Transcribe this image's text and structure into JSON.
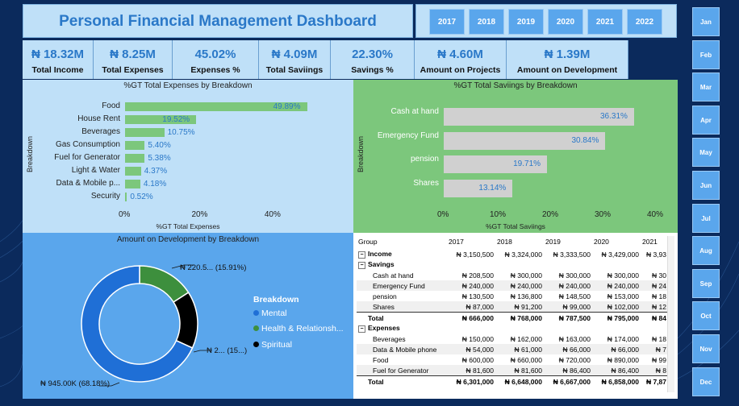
{
  "dashboard": {
    "title": "Personal Financial Management Dashboard"
  },
  "years": [
    "2017",
    "2018",
    "2019",
    "2020",
    "2021",
    "2022"
  ],
  "months": [
    "Jan",
    "Feb",
    "Mar",
    "Apr",
    "May",
    "Jun",
    "Jul",
    "Aug",
    "Sep",
    "Oct",
    "Nov",
    "Dec"
  ],
  "kpis": [
    {
      "value": "₦ 18.32M",
      "label": "Total Income"
    },
    {
      "value": "₦ 8.25M",
      "label": "Total Expenses"
    },
    {
      "value": "45.02%",
      "label": "Expenses %"
    },
    {
      "value": "₦ 4.09M",
      "label": "Total Saviings"
    },
    {
      "value": "22.30%",
      "label": "Savings %"
    },
    {
      "value": "₦ 4.60M",
      "label": "Amount on Projects"
    },
    {
      "value": "₦ 1.39M",
      "label": "Amount on Development"
    }
  ],
  "expenses_chart": {
    "title": "%GT Total Expenses by Breakdown",
    "y_axis_title": "Breakdown",
    "x_axis_title": "%GT Total Expenses",
    "x_ticks": [
      "0%",
      "20%",
      "40%"
    ],
    "categories": [
      "Food",
      "House Rent",
      "Beverages",
      "Gas Consumption",
      "Fuel for Generator",
      "Light & Water",
      "Data & Mobile p...",
      "Security"
    ],
    "labels": [
      "49.89%",
      "19.52%",
      "10.75%",
      "5.40%",
      "5.38%",
      "4.37%",
      "4.18%",
      "0.52%"
    ],
    "values": [
      49.89,
      19.52,
      10.75,
      5.4,
      5.38,
      4.37,
      4.18,
      0.52
    ],
    "xlim": [
      0,
      50
    ],
    "bar_color": "#7cc77c"
  },
  "savings_chart": {
    "title": "%GT Total Saviings by Breakdown",
    "y_axis_title": "Breakdown",
    "x_axis_title": "%GT Total Saviings",
    "x_ticks": [
      "0%",
      "10%",
      "20%",
      "30%",
      "40%"
    ],
    "categories": [
      "Cash at hand",
      "Emergency Fund",
      "pension",
      "Shares"
    ],
    "labels": [
      "36.31%",
      "30.84%",
      "19.71%",
      "13.14%"
    ],
    "values": [
      36.31,
      30.84,
      19.71,
      13.14
    ],
    "xlim": [
      0,
      40
    ],
    "bar_color": "#d0d0d0"
  },
  "development_chart": {
    "title": "Amount on Development by Breakdown",
    "legend_title": "Breakdown",
    "legend": [
      "Mental",
      "Health & Relationsh...",
      "Spiritual"
    ],
    "callouts": [
      "₦ 945.00K (68.18%)",
      "₦ 220.5... (15.91%)",
      "₦ 2... (15...)"
    ],
    "values": [
      68.18,
      15.91,
      15.91
    ],
    "colors": [
      "#1f6fd6",
      "#3d8f3d",
      "#000000"
    ]
  },
  "chart_data": [
    {
      "type": "bar",
      "title": "%GT Total Expenses by Breakdown",
      "xlabel": "%GT Total Expenses",
      "ylabel": "Breakdown",
      "categories": [
        "Food",
        "House Rent",
        "Beverages",
        "Gas Consumption",
        "Fuel for Generator",
        "Light & Water",
        "Data & Mobile p...",
        "Security"
      ],
      "values": [
        49.89,
        19.52,
        10.75,
        5.4,
        5.38,
        4.37,
        4.18,
        0.52
      ],
      "xlim": [
        0,
        50
      ]
    },
    {
      "type": "bar",
      "title": "%GT Total Saviings by Breakdown",
      "xlabel": "%GT Total Saviings",
      "ylabel": "Breakdown",
      "categories": [
        "Cash at hand",
        "Emergency Fund",
        "pension",
        "Shares"
      ],
      "values": [
        36.31,
        30.84,
        19.71,
        13.14
      ],
      "xlim": [
        0,
        40
      ]
    },
    {
      "type": "pie",
      "title": "Amount on Development by Breakdown",
      "categories": [
        "Mental",
        "Health & Relationsh...",
        "Spiritual"
      ],
      "values": [
        68.18,
        15.91,
        15.91
      ]
    }
  ],
  "matrix": {
    "headers": [
      "Group",
      "2017",
      "2018",
      "2019",
      "2020",
      "2021"
    ],
    "rows": [
      {
        "kind": "group",
        "cells": [
          "Income",
          "₦ 3,150,500",
          "₦ 3,324,000",
          "₦ 3,333,500",
          "₦ 3,429,000",
          "₦ 3,93"
        ]
      },
      {
        "kind": "group",
        "cells": [
          "Savings",
          "",
          "",
          "",
          "",
          ""
        ]
      },
      {
        "kind": "item",
        "cells": [
          "Cash at hand",
          "₦ 208,500",
          "₦ 300,000",
          "₦ 300,000",
          "₦ 300,000",
          "₦ 30"
        ]
      },
      {
        "kind": "item",
        "cells": [
          "Emergency Fund",
          "₦ 240,000",
          "₦ 240,000",
          "₦ 240,000",
          "₦ 240,000",
          "₦ 24"
        ]
      },
      {
        "kind": "item",
        "cells": [
          "pension",
          "₦ 130,500",
          "₦ 136,800",
          "₦ 148,500",
          "₦ 153,000",
          "₦ 18"
        ]
      },
      {
        "kind": "item",
        "cells": [
          "Shares",
          "₦ 87,000",
          "₦ 91,200",
          "₦ 99,000",
          "₦ 102,000",
          "₦ 12"
        ]
      },
      {
        "kind": "total",
        "cells": [
          "Total",
          "₦ 666,000",
          "₦ 768,000",
          "₦ 787,500",
          "₦ 795,000",
          "₦ 84"
        ]
      },
      {
        "kind": "group",
        "cells": [
          "Expenses",
          "",
          "",
          "",
          "",
          ""
        ]
      },
      {
        "kind": "item",
        "cells": [
          "Beverages",
          "₦ 150,000",
          "₦ 162,000",
          "₦ 163,000",
          "₦ 174,000",
          "₦ 18"
        ]
      },
      {
        "kind": "item",
        "cells": [
          "Data & Mobile phone",
          "₦ 54,000",
          "₦ 61,000",
          "₦ 66,000",
          "₦ 66,000",
          "₦ 7"
        ]
      },
      {
        "kind": "item",
        "cells": [
          "Food",
          "₦ 600,000",
          "₦ 660,000",
          "₦ 720,000",
          "₦ 890,000",
          "₦ 99"
        ]
      },
      {
        "kind": "item",
        "cells": [
          "Fuel for Generator",
          "₦ 81,600",
          "₦ 81,600",
          "₦ 86,400",
          "₦ 86,400",
          "₦ 8"
        ]
      },
      {
        "kind": "total",
        "cells": [
          "Total",
          "₦ 6,301,000",
          "₦ 6,648,000",
          "₦ 6,667,000",
          "₦ 6,858,000",
          "₦ 7,87"
        ]
      }
    ]
  }
}
